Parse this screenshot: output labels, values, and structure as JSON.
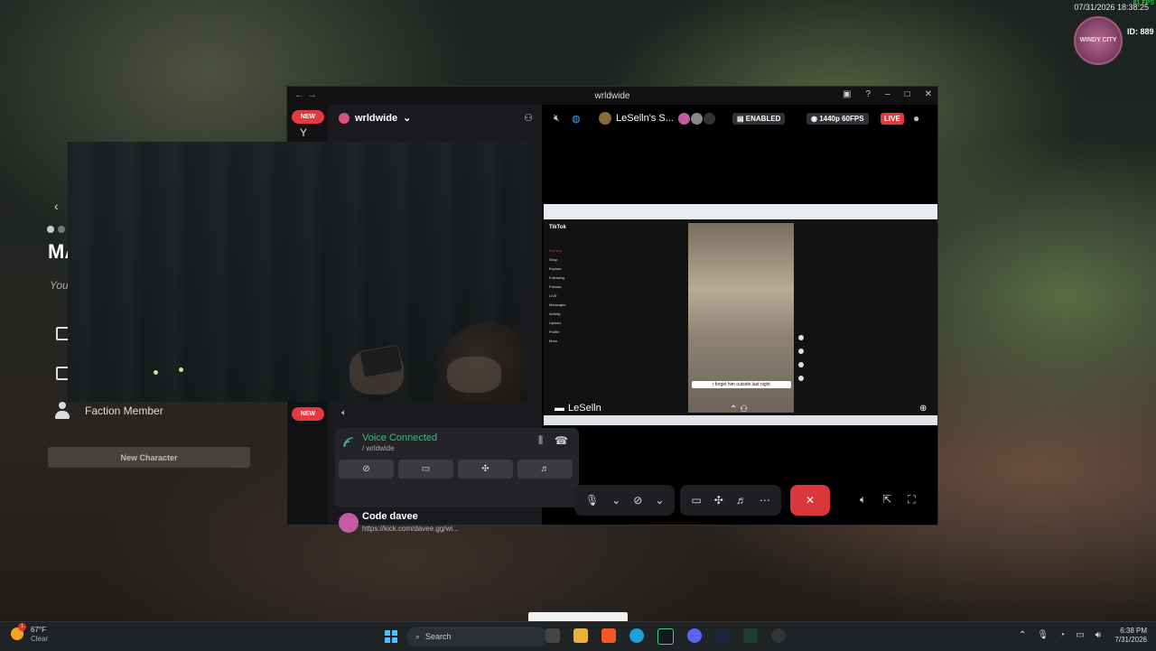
{
  "hud": {
    "datetime": "07/31/2026 18:38:25",
    "fps": "81 FPS",
    "logo_text": "WINDY CITY",
    "id_label": "ID: 889"
  },
  "game_panel": {
    "heading_partial": "MA",
    "subheading_partial": "You",
    "faction_label": "Faction Member",
    "new_character_button": "New Character"
  },
  "discord": {
    "window_title": "wrldwide",
    "server_name": "wrldwide",
    "new_badge": "NEW",
    "server_initial": "Y",
    "voice": {
      "status": "Voice Connected",
      "channel": "/ wrldwide"
    },
    "user": {
      "name": "Code davee",
      "status": "https://kick.com/davee.gg/wi..."
    },
    "stream": {
      "streamer_title": "LeSelln's S...",
      "encrypted_label": "ENABLED",
      "quality_label": "1440p 60FPS",
      "live_label": "LIVE",
      "streamer_name": "LeSelln"
    },
    "tiktok": {
      "app_name": "TikTok",
      "nav_items": [
        "For You",
        "Shop",
        "Explore",
        "Following",
        "Friends",
        "LIVE",
        "Messages",
        "Activity",
        "Upload",
        "Profile",
        "More"
      ],
      "caption": "i forget him outside last night"
    }
  },
  "taskbar": {
    "weather_temp": "67°F",
    "weather_desc": "Clear",
    "weather_alert_count": "1",
    "search_placeholder": "Search",
    "time": "6:38 PM",
    "date": "7/31/2026"
  },
  "colors": {
    "accent_red": "#e23b3f",
    "voice_green": "#43b581",
    "end_call": "#da373c",
    "hud_fps": "#35ff4a"
  }
}
